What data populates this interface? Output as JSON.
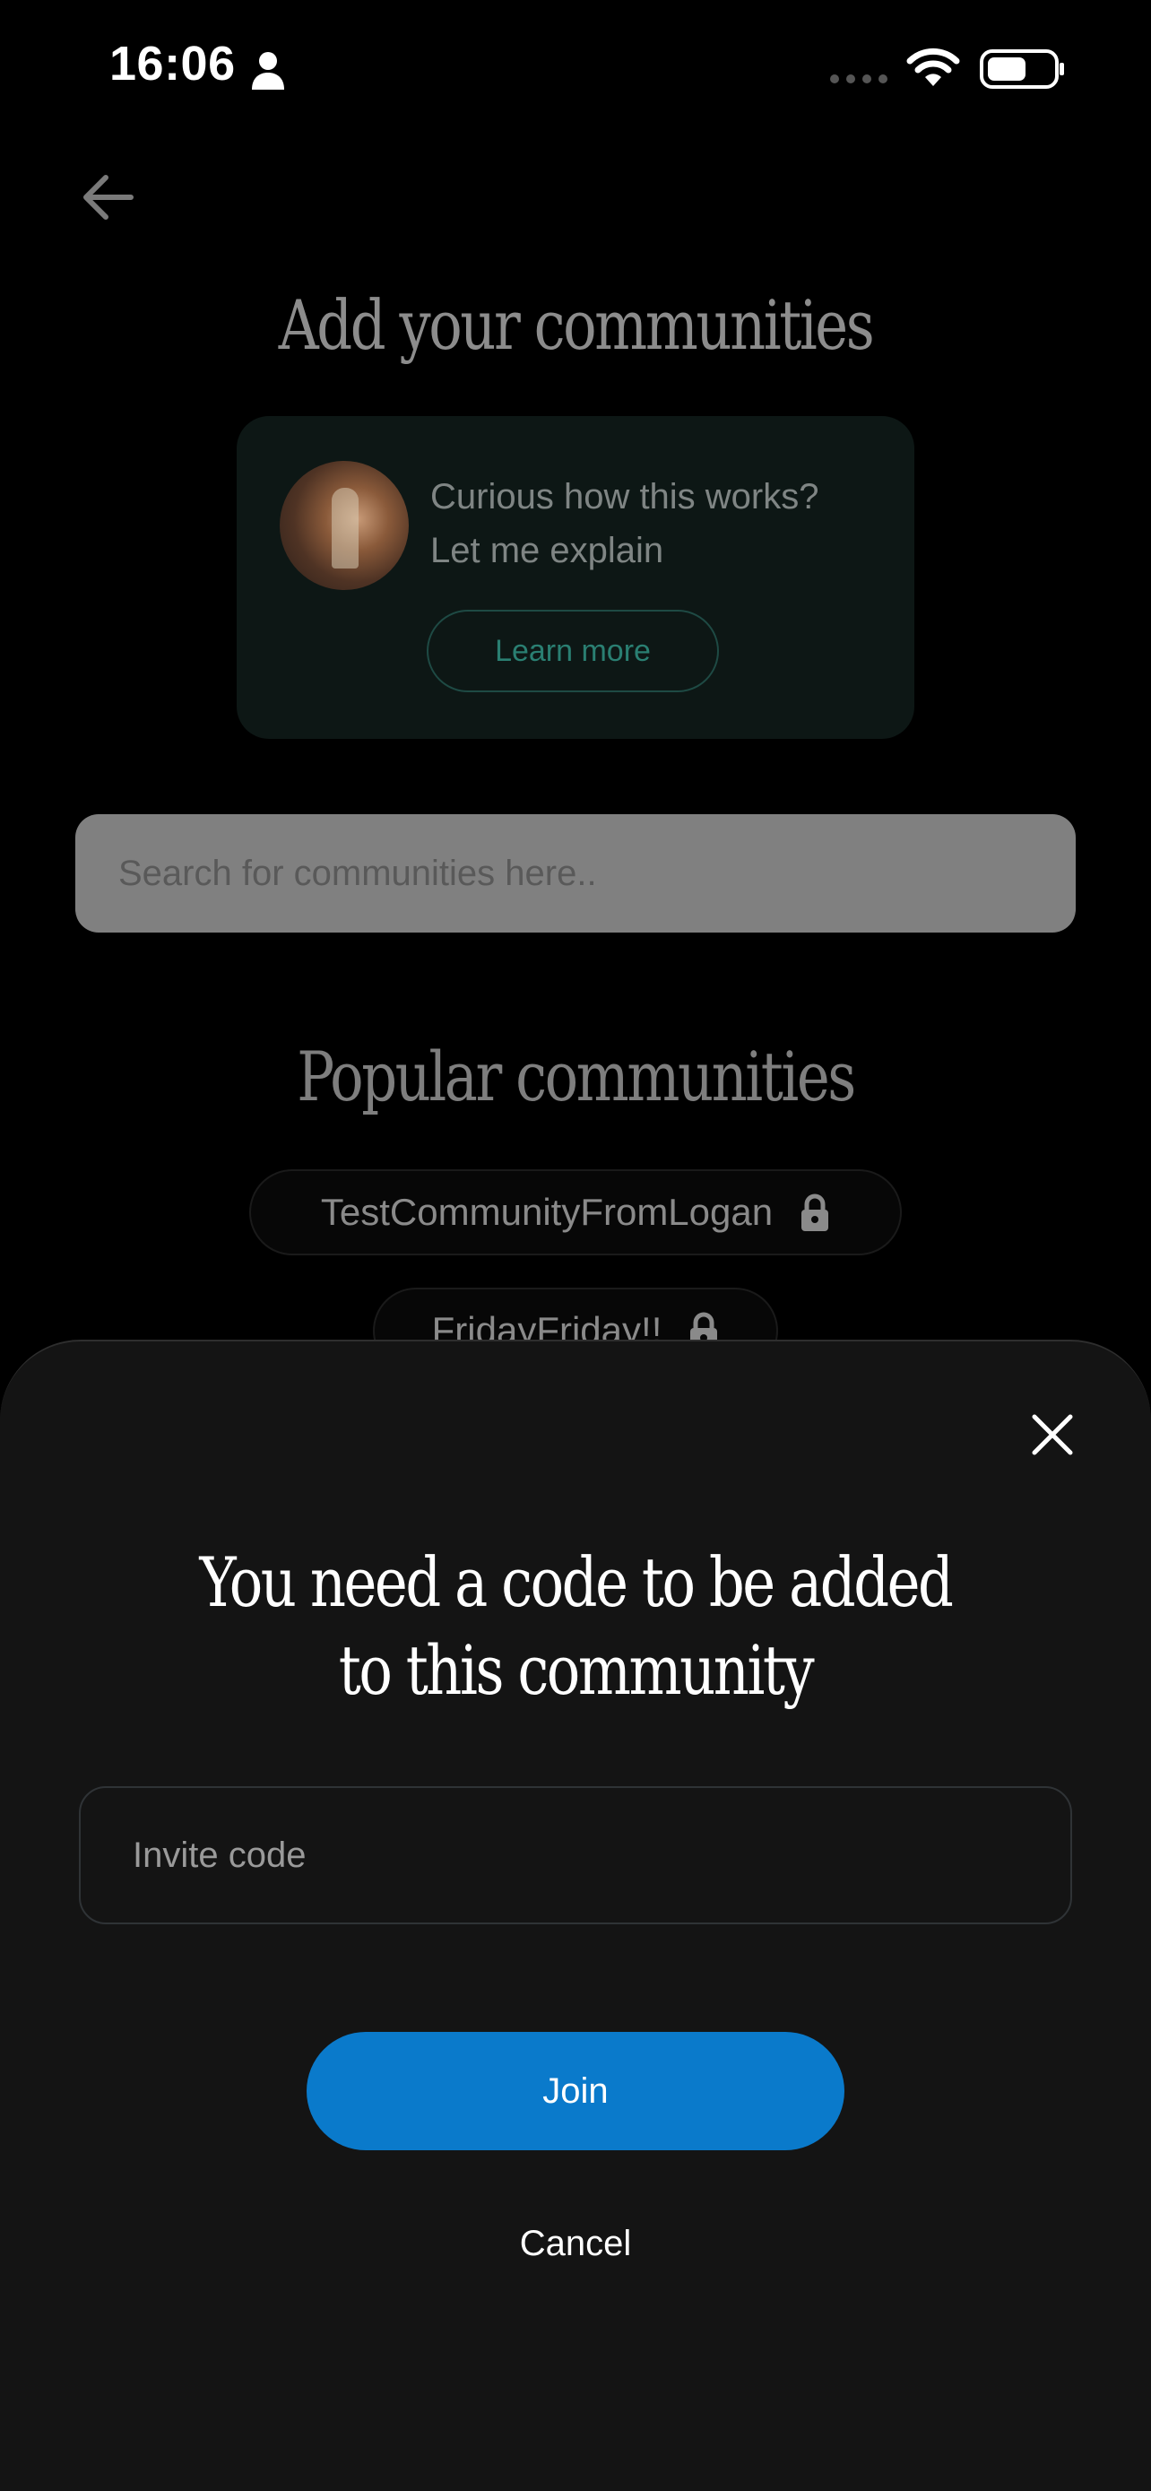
{
  "status_bar": {
    "time": "16:06",
    "icons": [
      "person-icon",
      "signal-icon",
      "wifi-icon",
      "battery-icon"
    ]
  },
  "background": {
    "back_icon": "arrow-left-icon",
    "title": "Add your communities",
    "explain_card": {
      "line1": "Curious how this works?",
      "line2": "Let me explain",
      "learn_more_label": "Learn more"
    },
    "search": {
      "placeholder": "Search for communities here.."
    },
    "popular_title": "Popular communities",
    "communities": [
      {
        "name": "TestCommunityFromLogan",
        "locked": true
      },
      {
        "name": "FridayFriday!!",
        "locked": true
      }
    ]
  },
  "modal": {
    "close_icon": "close-icon",
    "title_line1": "You need a code to be added",
    "title_line2": "to this community",
    "invite_placeholder": "Invite code",
    "join_label": "Join",
    "cancel_label": "Cancel"
  },
  "colors": {
    "accent": "#0a7acb",
    "sheet_bg": "#141414",
    "teal_text": "#2a7f72"
  }
}
